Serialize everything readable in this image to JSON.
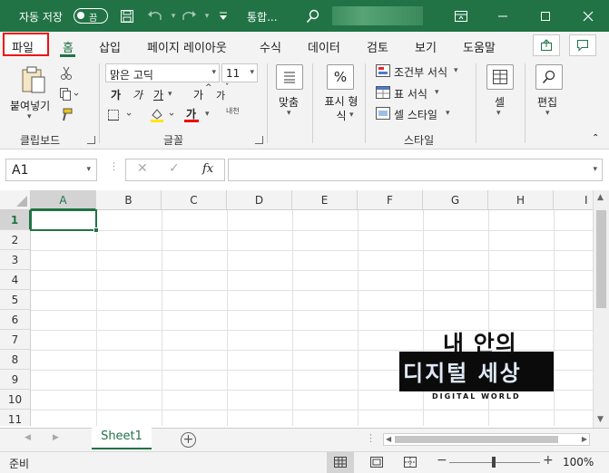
{
  "titlebar": {
    "autosave_label": "자동 저장",
    "autosave_state": "끔",
    "doc_title": "통합..."
  },
  "tabs": [
    "파일",
    "홈",
    "삽입",
    "페이지 레이아웃",
    "수식",
    "데이터",
    "검토",
    "보기",
    "도움말"
  ],
  "ribbon": {
    "paste_label": "붙여넣기",
    "font_name": "맑은 고딕",
    "font_size": "11",
    "bold": "가",
    "italic": "가",
    "underline": "가",
    "grow_font": "가",
    "shrink_font": "가",
    "font_color_glyph": "가",
    "phonetic": "내천",
    "align_label": "맞춤",
    "number_label": "표시 형식",
    "conditional_format": "조건부 서식",
    "table_format": "표 서식",
    "cell_style": "셀 스타일",
    "cells_label": "셀",
    "editing_label": "편집",
    "group_clipboard": "클립보드",
    "group_font": "글꼴",
    "group_styles": "스타일"
  },
  "formula": {
    "namebox": "A1",
    "fx": "fx",
    "value": ""
  },
  "grid": {
    "columns": [
      "A",
      "B",
      "C",
      "D",
      "E",
      "F",
      "G",
      "H",
      "I"
    ],
    "rows": [
      "1",
      "2",
      "3",
      "4",
      "5",
      "6",
      "7",
      "8",
      "9",
      "10",
      "11"
    ],
    "selected_cell": "A1"
  },
  "sheets": [
    "Sheet1"
  ],
  "status": {
    "mode": "준비",
    "zoom": "100%"
  },
  "watermark": {
    "line1": "내 안의",
    "line2": "디지털 세상",
    "line3": "DIGITAL WORLD"
  }
}
